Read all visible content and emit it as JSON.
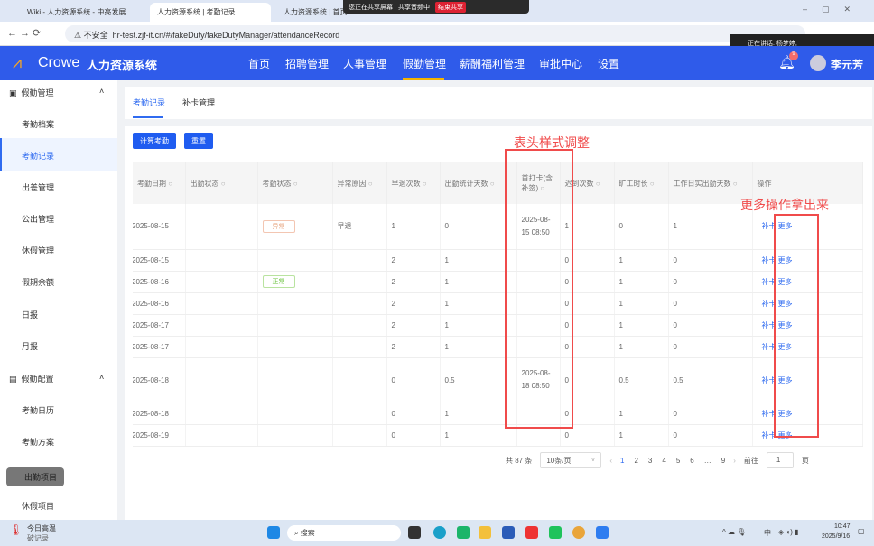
{
  "browser": {
    "tabs": [
      "Wiki - 人力资源系统 - 中亮发展",
      "人力资源系统 | 考勤记录",
      "人力资源系统 | 首页"
    ],
    "insecure": "不安全",
    "url": "hr-test.zjf-it.cn/#/fakeDuty/fakeDutyManager/attendanceRecord",
    "share_text": "您正在共享屏幕",
    "share_audio": "共享音频中",
    "stop_share": "结束共享",
    "speaking": "正在讲话: 杨梦婷;"
  },
  "app": {
    "logo": "Crowe",
    "title": "人力资源系统",
    "nav": [
      "首页",
      "招聘管理",
      "人事管理",
      "假勤管理",
      "薪酬福利管理",
      "审批中心",
      "设置"
    ],
    "active_nav": 3,
    "badge": "9",
    "user": "李元芳"
  },
  "sidebar": {
    "group1": "假勤管理",
    "items1": [
      "考勤档案",
      "考勤记录",
      "出差管理",
      "公出管理",
      "休假管理",
      "假期余额",
      "日报",
      "月报"
    ],
    "group2": "假勤配置",
    "items2": [
      "考勤日历",
      "考勤方案",
      "出勤项目",
      "休假项目"
    ]
  },
  "tabs": [
    "考勤记录",
    "补卡管理"
  ],
  "buttons": {
    "calc": "计算考勤",
    "reset": "重置"
  },
  "table": {
    "headers": [
      "考勤日期",
      "出勤状态",
      "考勤状态",
      "异常原因",
      "早退次数",
      "出勤统计天数",
      "首打卡(含补签)",
      "迟到次数",
      "旷工时长",
      "工作日实出勤天数",
      "操作"
    ],
    "rows": [
      [
        "2025-08-15",
        "",
        "异常",
        "早退",
        "1",
        "0",
        "2025-08-15 08:50",
        "1",
        "0",
        "1"
      ],
      [
        "2025-08-15",
        "",
        "",
        "",
        "2",
        "1",
        "",
        "0",
        "1",
        "0"
      ],
      [
        "2025-08-16",
        "",
        "正常",
        "",
        "2",
        "1",
        "",
        "0",
        "1",
        "0"
      ],
      [
        "2025-08-16",
        "",
        "",
        "",
        "2",
        "1",
        "",
        "0",
        "1",
        "0"
      ],
      [
        "2025-08-17",
        "",
        "",
        "",
        "2",
        "1",
        "",
        "0",
        "1",
        "0"
      ],
      [
        "2025-08-17",
        "",
        "",
        "",
        "2",
        "1",
        "",
        "0",
        "1",
        "0"
      ],
      [
        "2025-08-18",
        "",
        "",
        "",
        "0",
        "0.5",
        "2025-08-18 08:50",
        "0",
        "0.5",
        "0.5"
      ],
      [
        "2025-08-18",
        "",
        "",
        "",
        "0",
        "1",
        "",
        "0",
        "1",
        "0"
      ],
      [
        "2025-08-19",
        "",
        "",
        "",
        "0",
        "1",
        "",
        "0",
        "1",
        "0"
      ]
    ],
    "actions": [
      "补卡",
      "更多"
    ]
  },
  "pagination": {
    "total": "共 87 条",
    "page_size": "10条/页",
    "pages": [
      "1",
      "2",
      "3",
      "4",
      "5",
      "6",
      "…",
      "9"
    ],
    "current": "1",
    "goto": "前往",
    "goto_value": "1",
    "page_unit": "页"
  },
  "annotations": [
    "表头样式调整",
    "更多操作拿出来"
  ],
  "taskbar": {
    "weather": "今日高温",
    "weather_sub": "破记录",
    "search": "搜索",
    "ime": "中",
    "time": "10:47",
    "date": "2025/9/16"
  },
  "colors": {
    "primary": "#2f5bea",
    "annotation": "#f04b4b"
  }
}
